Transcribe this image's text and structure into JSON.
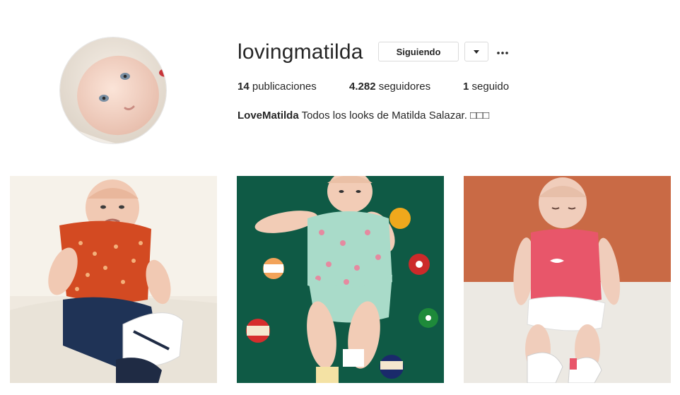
{
  "profile": {
    "username": "lovingmatilda",
    "follow_button_label": "Siguiendo",
    "dropdown_icon": "caret-down-icon",
    "more_icon": "more-options-icon",
    "stats": {
      "posts_count": "14",
      "posts_label": "publicaciones",
      "followers_count": "4.282",
      "followers_label": "seguidores",
      "following_count": "1",
      "following_label": "seguido"
    },
    "bio": {
      "name": "LoveMatilda",
      "text": "Todos los looks de Matilda Salazar. □□□"
    }
  },
  "posts": [
    {
      "id": "post-1",
      "background": "#efe9df"
    },
    {
      "id": "post-2",
      "background": "#0f5a45"
    },
    {
      "id": "post-3",
      "background": "#c96a45"
    }
  ]
}
